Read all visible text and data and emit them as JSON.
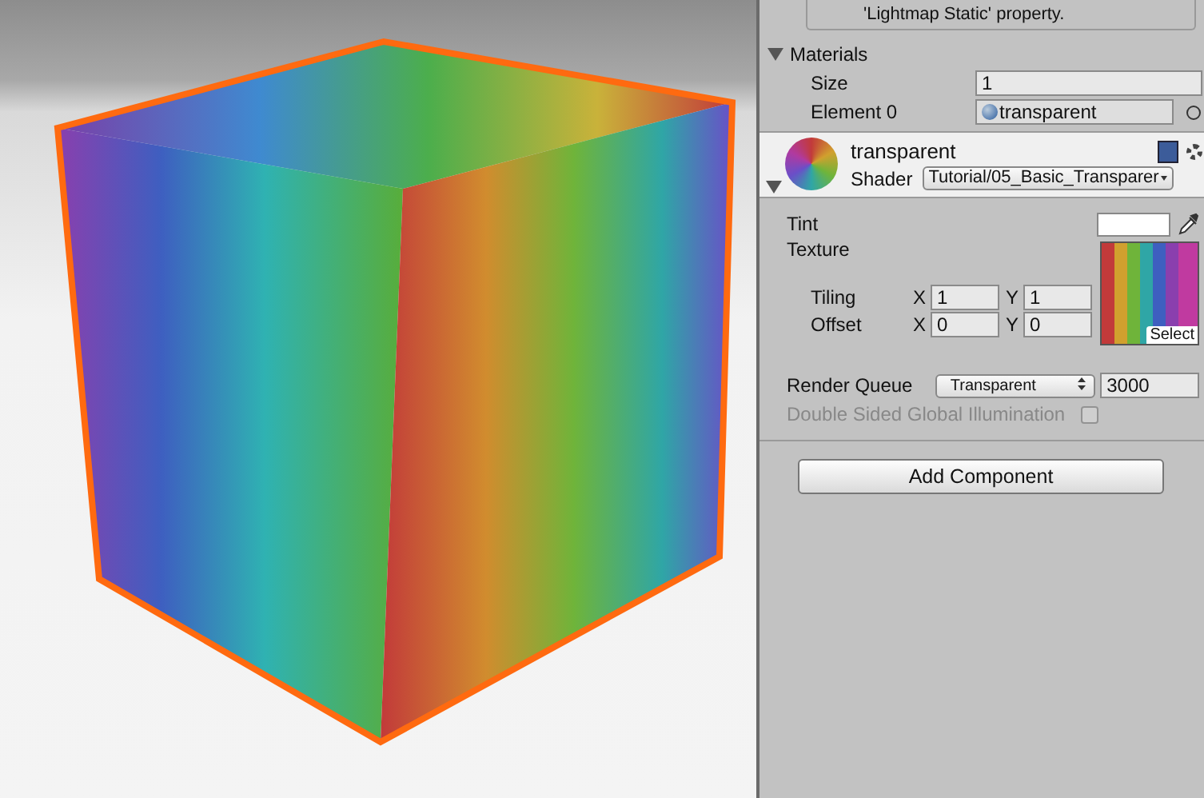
{
  "info_box": {
    "lines": [
      "'Lightmap Static' property."
    ]
  },
  "materials": {
    "label": "Materials",
    "expanded": true,
    "size_label": "Size",
    "size": "1",
    "elements": [
      {
        "label": "Element 0",
        "value": "transparent"
      }
    ]
  },
  "material": {
    "name": "transparent",
    "shader_label": "Shader",
    "shader": "Tutorial/05_Basic_Transparer",
    "expanded": true
  },
  "tint": {
    "label": "Tint"
  },
  "texture": {
    "label": "Texture",
    "select": "Select",
    "rows": [
      {
        "label": "Tiling",
        "fields": [
          {
            "axis": "X",
            "value": "1"
          },
          {
            "axis": "Y",
            "value": "1"
          }
        ]
      },
      {
        "label": "Offset",
        "fields": [
          {
            "axis": "X",
            "value": "0"
          },
          {
            "axis": "Y",
            "value": "0"
          }
        ]
      }
    ]
  },
  "render_queue": {
    "label": "Render Queue",
    "mode": "Transparent",
    "value": "3000"
  },
  "double_sided_gi": {
    "label": "Double Sided Global Illumination",
    "checked": false,
    "disabled": true
  },
  "add_component": "Add Component"
}
